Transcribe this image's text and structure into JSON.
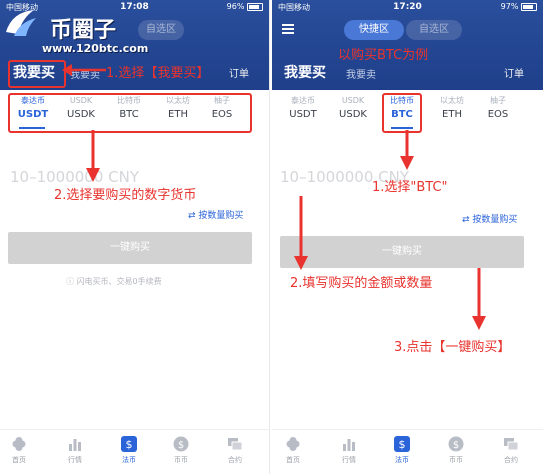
{
  "left": {
    "status": {
      "carrier": "中国移动",
      "time": "17:08",
      "battery": "96%"
    },
    "logo": {
      "name": "币圈子",
      "url": "www.120btc.com"
    },
    "segment_inactive": "自选区",
    "tabs": {
      "main": "我要买",
      "sub": "我要卖",
      "order": "订单"
    },
    "currencies": [
      {
        "cn": "泰达币",
        "code": "USDT"
      },
      {
        "cn": "USDK",
        "code": "USDK"
      },
      {
        "cn": "比特币",
        "code": "BTC"
      },
      {
        "cn": "以太坊",
        "code": "ETH"
      },
      {
        "cn": "柚子",
        "code": "EOS"
      }
    ],
    "input_placeholder": "10–1000000 CNY",
    "qty_link": "按数量购买",
    "buy_button": "一键购买",
    "notice": "闪电买币、交易0手续费",
    "tabbar": [
      "首页",
      "行情",
      "法币",
      "币币",
      "合约"
    ]
  },
  "right": {
    "status": {
      "carrier": "中国移动",
      "time": "17:20",
      "battery": "97%"
    },
    "segments": {
      "active": "快捷区",
      "inactive": "自选区"
    },
    "tabs": {
      "main": "我要买",
      "sub": "我要卖",
      "order": "订单"
    },
    "currencies": [
      {
        "cn": "泰达币",
        "code": "USDT"
      },
      {
        "cn": "USDK",
        "code": "USDK"
      },
      {
        "cn": "比特币",
        "code": "BTC"
      },
      {
        "cn": "以太坊",
        "code": "ETH"
      },
      {
        "cn": "柚子",
        "code": "EOS"
      }
    ],
    "input_placeholder": "10–1000000 CNY",
    "qty_link": "按数量购买",
    "buy_button": "一键购买",
    "tabbar": [
      "首页",
      "行情",
      "法币",
      "币币",
      "合约"
    ]
  },
  "annotations": {
    "step1_left": "1.选择【我要买】",
    "step2_left": "2.选择要购买的数字货币",
    "example": "以购买BTC为例",
    "step1_right": "1.选择\"BTC\"",
    "step2_right": "2.填写购买的金额或数量",
    "step3_right": "3.点击【一键购买】"
  },
  "colors": {
    "header": "#1f3f8a",
    "accent": "#2b63d9",
    "annotation": "#e8332e",
    "button": "#d2d2d2"
  }
}
